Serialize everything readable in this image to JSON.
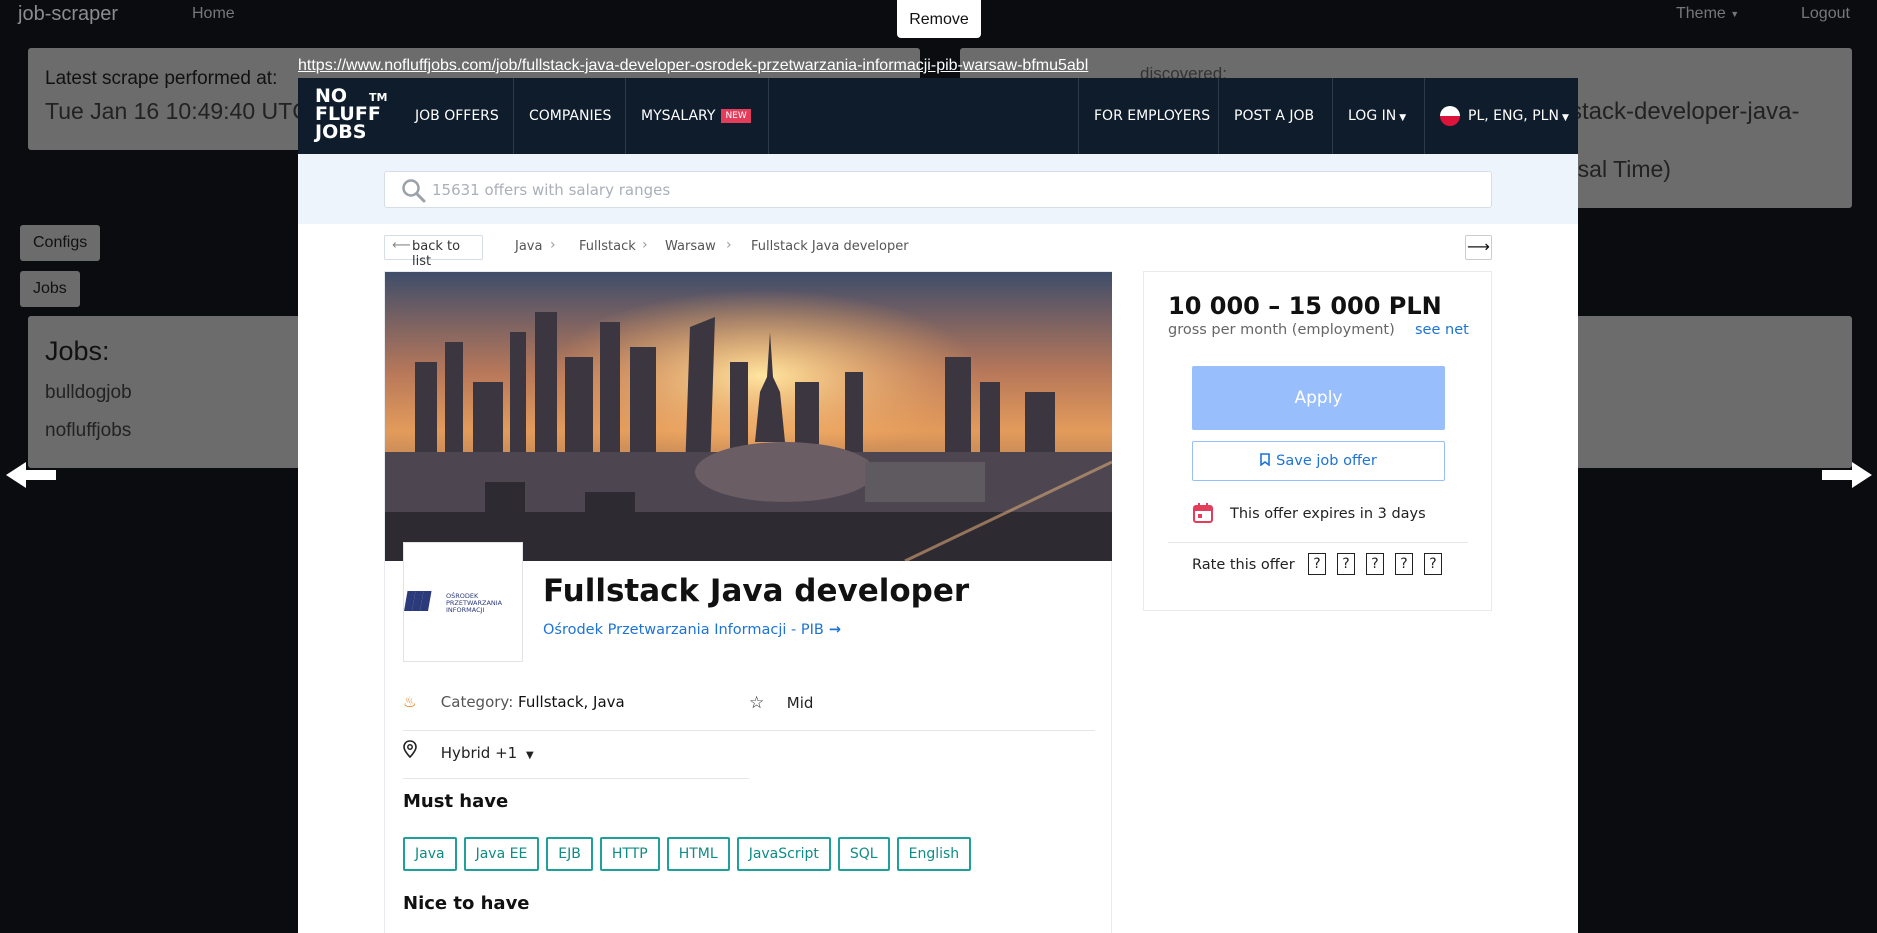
{
  "app": {
    "brand": "job-scraper",
    "nav_home": "Home",
    "nav_theme": "Theme",
    "nav_logout": "Logout"
  },
  "scrape_card": {
    "label": "Latest scrape performed at:",
    "value": "Tue Jan 16 10:49:40 UTC"
  },
  "right_card": {
    "line1": "discovered:",
    "line2": "stack-developer-java-",
    "line3": "rsal Time)"
  },
  "side_buttons": {
    "configs": "Configs",
    "jobs": "Jobs"
  },
  "jobs_card": {
    "heading": "Jobs:",
    "items": [
      "bulldogjob",
      "nofluffjobs"
    ]
  },
  "overlay": {
    "remove_label": "Remove",
    "url": "https://www.nofluffjobs.com/job/fullstack-java-developer-osrodek-przetwarzania-informacji-pib-warsaw-bfmu5abl"
  },
  "nfj": {
    "logo_line1": "NO",
    "logo_line2": "FLUFF",
    "logo_line3": "JOBS",
    "logo_tm": "TM",
    "nav": {
      "job_offers": "JOB OFFERS",
      "companies": "COMPANIES",
      "mysalary": "MYSALARY",
      "new_badge": "NEW",
      "for_employers": "FOR EMPLOYERS",
      "post_a_job": "POST A JOB",
      "log_in": "LOG IN",
      "locale": "PL, ENG, PLN"
    },
    "search_placeholder": "15631 offers with salary ranges",
    "back_label": "back to list",
    "breadcrumbs": [
      "Java",
      "Fullstack",
      "Warsaw",
      "Fullstack Java developer"
    ],
    "job_title": "Fullstack Java developer",
    "company": "Ośrodek Przetwarzania Informacji - PIB",
    "company_logo_text": "OŚRODEK PRZETWARZANIA INFORMACJI",
    "category_label": "Category:",
    "category_value": "Fullstack, Java",
    "seniority": "Mid",
    "location": "Hybrid +1",
    "must_have_heading": "Must have",
    "must_have": [
      "Java",
      "Java EE",
      "EJB",
      "HTTP",
      "HTML",
      "JavaScript",
      "SQL",
      "English"
    ],
    "nice_to_have_heading": "Nice to have",
    "salary": "10 000 – 15 000 PLN",
    "salary_sub": "gross per month (employment)",
    "see_net": "see net",
    "apply_label": "Apply",
    "save_label": "Save job offer",
    "expires_text": "This offer expires in 3 days",
    "rate_label": "Rate this offer",
    "colors": {
      "navy": "#0f1c2b",
      "accent_blue": "#1d73d6",
      "apply_bg": "#98befb",
      "tag_teal": "#1fa098",
      "badge_red": "#e43d5c"
    }
  }
}
